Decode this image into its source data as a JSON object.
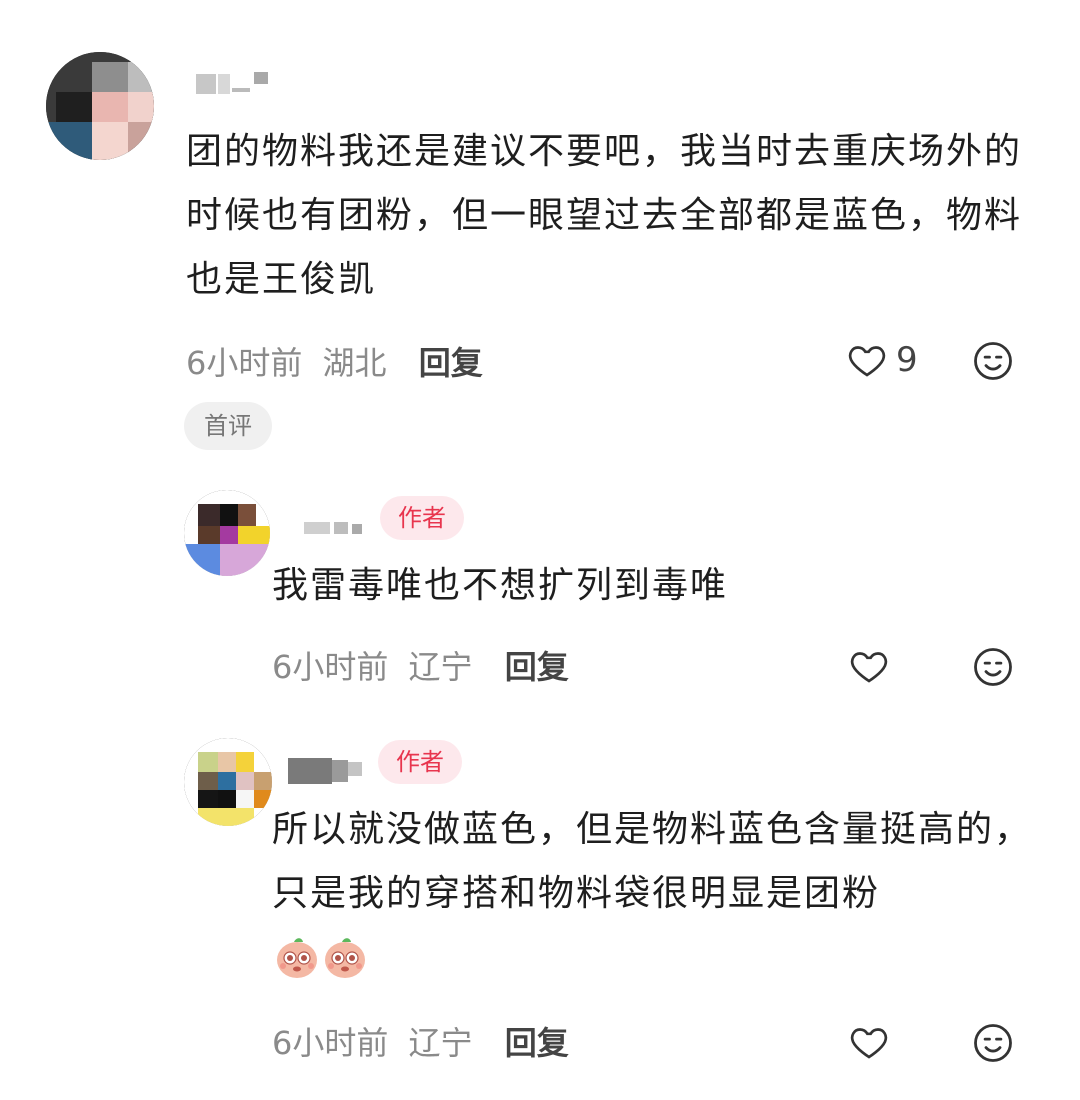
{
  "comments": [
    {
      "text": "团的物料我还是建议不要吧，我当时去重庆场外的时候也有团粉，但一眼望过去全部都是蓝色，物料也是王俊凯",
      "time": "6小时前",
      "location": "湖北",
      "reply_label": "回复",
      "like_count": "9",
      "tag": "首评"
    }
  ],
  "replies": [
    {
      "badge": "作者",
      "text": "我雷毒唯也不想扩列到毒唯",
      "time": "6小时前",
      "location": "辽宁",
      "reply_label": "回复"
    },
    {
      "badge": "作者",
      "text": "所以就没做蓝色，但是物料蓝色含量挺高的，只是我的穿搭和物料袋很明显是团粉",
      "time": "6小时前",
      "location": "辽宁",
      "reply_label": "回复"
    }
  ],
  "icons": {
    "like": "heart-outline-icon",
    "emoji": "emoji-face-icon",
    "sticker": "cute-face-sticker"
  },
  "colors": {
    "author_badge_bg": "#fde8ec",
    "author_badge_text": "#e8354e",
    "meta_text": "#8a8a8a"
  }
}
